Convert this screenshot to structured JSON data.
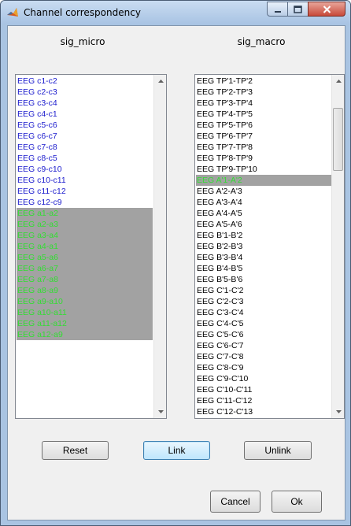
{
  "window": {
    "title": "Channel correspondency"
  },
  "left_header": "sig_micro",
  "right_header": "sig_macro",
  "left_list": {
    "items": [
      {
        "label": "EEG c1-c2",
        "selected": false
      },
      {
        "label": "EEG c2-c3",
        "selected": false
      },
      {
        "label": "EEG c3-c4",
        "selected": false
      },
      {
        "label": "EEG c4-c1",
        "selected": false
      },
      {
        "label": "EEG c5-c6",
        "selected": false
      },
      {
        "label": "EEG c6-c7",
        "selected": false
      },
      {
        "label": "EEG c7-c8",
        "selected": false
      },
      {
        "label": "EEG c8-c5",
        "selected": false
      },
      {
        "label": "EEG c9-c10",
        "selected": false
      },
      {
        "label": "EEG c10-c11",
        "selected": false
      },
      {
        "label": "EEG c11-c12",
        "selected": false
      },
      {
        "label": "EEG c12-c9",
        "selected": false
      },
      {
        "label": "EEG a1-a2",
        "selected": true
      },
      {
        "label": "EEG a2-a3",
        "selected": true
      },
      {
        "label": "EEG a3-a4",
        "selected": true
      },
      {
        "label": "EEG a4-a1",
        "selected": true
      },
      {
        "label": "EEG a5-a6",
        "selected": true
      },
      {
        "label": "EEG a6-a7",
        "selected": true
      },
      {
        "label": "EEG a7-a8",
        "selected": true
      },
      {
        "label": "EEG a8-a9",
        "selected": true
      },
      {
        "label": "EEG a9-a10",
        "selected": true
      },
      {
        "label": "EEG a10-a11",
        "selected": true
      },
      {
        "label": "EEG a11-a12",
        "selected": true
      },
      {
        "label": "EEG a12-a9",
        "selected": true
      }
    ]
  },
  "right_list": {
    "items": [
      {
        "label": "EEG TP'1-TP'2",
        "selected": false
      },
      {
        "label": "EEG TP'2-TP'3",
        "selected": false
      },
      {
        "label": "EEG TP'3-TP'4",
        "selected": false
      },
      {
        "label": "EEG TP'4-TP'5",
        "selected": false
      },
      {
        "label": "EEG TP'5-TP'6",
        "selected": false
      },
      {
        "label": "EEG TP'6-TP'7",
        "selected": false
      },
      {
        "label": "EEG TP'7-TP'8",
        "selected": false
      },
      {
        "label": "EEG TP'8-TP'9",
        "selected": false
      },
      {
        "label": "EEG TP'9-TP'10",
        "selected": false
      },
      {
        "label": "EEG A'1-A'2",
        "selected": true
      },
      {
        "label": "EEG A'2-A'3",
        "selected": false
      },
      {
        "label": "EEG A'3-A'4",
        "selected": false
      },
      {
        "label": "EEG A'4-A'5",
        "selected": false
      },
      {
        "label": "EEG A'5-A'6",
        "selected": false
      },
      {
        "label": "EEG B'1-B'2",
        "selected": false
      },
      {
        "label": "EEG B'2-B'3",
        "selected": false
      },
      {
        "label": "EEG B'3-B'4",
        "selected": false
      },
      {
        "label": "EEG B'4-B'5",
        "selected": false
      },
      {
        "label": "EEG B'5-B'6",
        "selected": false
      },
      {
        "label": "EEG C'1-C'2",
        "selected": false
      },
      {
        "label": "EEG C'2-C'3",
        "selected": false
      },
      {
        "label": "EEG C'3-C'4",
        "selected": false
      },
      {
        "label": "EEG C'4-C'5",
        "selected": false
      },
      {
        "label": "EEG C'5-C'6",
        "selected": false
      },
      {
        "label": "EEG C'6-C'7",
        "selected": false
      },
      {
        "label": "EEG C'7-C'8",
        "selected": false
      },
      {
        "label": "EEG C'8-C'9",
        "selected": false
      },
      {
        "label": "EEG C'9-C'10",
        "selected": false
      },
      {
        "label": "EEG C'10-C'11",
        "selected": false
      },
      {
        "label": "EEG C'11-C'12",
        "selected": false
      },
      {
        "label": "EEG C'12-C'13",
        "selected": false
      }
    ]
  },
  "buttons": {
    "reset": "Reset",
    "link": "Link",
    "unlink": "Unlink",
    "cancel": "Cancel",
    "ok": "Ok"
  },
  "colors": {
    "left_item_text": "#1a1acd",
    "selected_bg": "#a2a2a2",
    "selected_text": "#33dd33"
  },
  "icons": {
    "app": "matlab-icon",
    "minimize": "minimize-icon",
    "maximize": "maximize-icon",
    "close": "close-icon"
  }
}
